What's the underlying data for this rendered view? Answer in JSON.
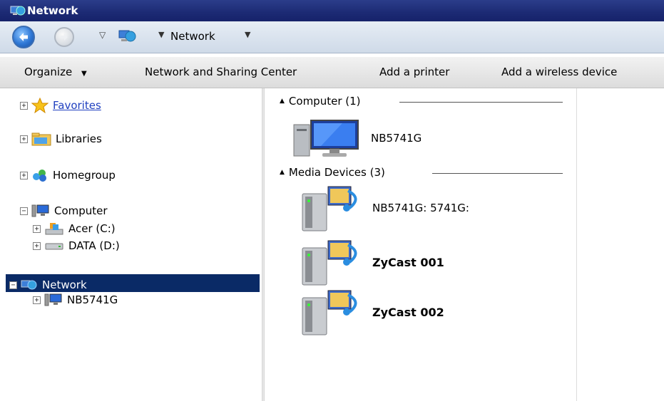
{
  "window": {
    "title": "Network"
  },
  "address": {
    "location": "Network"
  },
  "toolbar": {
    "organize": "Organize",
    "network_sharing": "Network and Sharing Center",
    "add_printer": "Add a printer",
    "add_wireless": "Add a wireless device"
  },
  "nav": {
    "favorites": "Favorites",
    "libraries": "Libraries",
    "homegroup": "Homegroup",
    "computer": "Computer",
    "drive_c": "Acer (C:)",
    "drive_d": "DATA (D:)",
    "network": "Network",
    "network_child": "NB5741G"
  },
  "content": {
    "computer_group": "Computer (1)",
    "computer_items": [
      "NB5741G"
    ],
    "media_group": "Media Devices (3)",
    "media_items": [
      "NB5741G: 5741G:",
      "ZyCast 001",
      "ZyCast 002"
    ]
  },
  "colors": {
    "titlebar": "#1c2a74",
    "selection": "#0a2a66",
    "link": "#1f3fbf"
  }
}
